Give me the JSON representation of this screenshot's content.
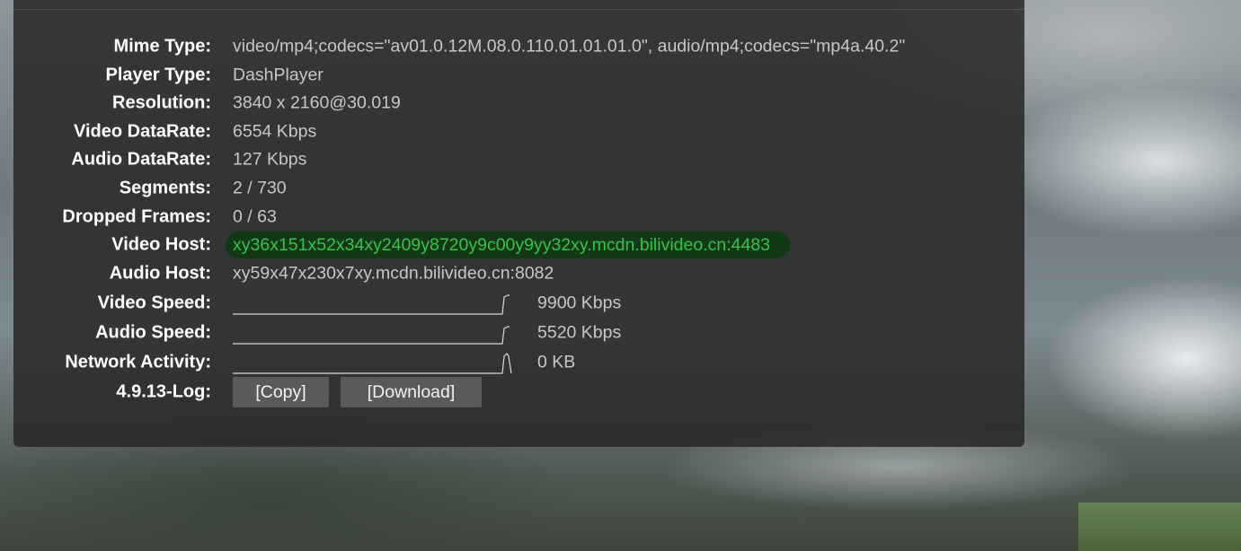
{
  "stats": {
    "mime_type": {
      "label": "Mime Type:",
      "value": "video/mp4;codecs=\"av01.0.12M.08.0.110.01.01.01.0\", audio/mp4;codecs=\"mp4a.40.2\""
    },
    "player_type": {
      "label": "Player Type:",
      "value": "DashPlayer"
    },
    "resolution": {
      "label": "Resolution:",
      "value": "3840 x 2160@30.019"
    },
    "video_datarate": {
      "label": "Video DataRate:",
      "value": "6554 Kbps"
    },
    "audio_datarate": {
      "label": "Audio DataRate:",
      "value": "127 Kbps"
    },
    "segments": {
      "label": "Segments:",
      "value": "2 / 730"
    },
    "dropped_frames": {
      "label": "Dropped Frames:",
      "value": "0 / 63"
    },
    "video_host": {
      "label": "Video Host:",
      "value": "xy36x151x52x34xy2409y8720y9c00y9yy32xy.mcdn.bilivideo.cn:4483"
    },
    "audio_host": {
      "label": "Audio Host:",
      "value": "xy59x47x230x7xy.mcdn.bilivideo.cn:8082"
    },
    "video_speed": {
      "label": "Video Speed:",
      "value": "9900 Kbps"
    },
    "audio_speed": {
      "label": "Audio Speed:",
      "value": "5520 Kbps"
    },
    "network_activity": {
      "label": "Network Activity:",
      "value": "0 KB"
    },
    "log": {
      "label": "4.9.13-Log:",
      "copy_label": "[Copy]",
      "download_label": "[Download]"
    }
  },
  "colors": {
    "panel_bg": "#282828",
    "label_text": "#ffffff",
    "value_text": "#c7c7c7",
    "highlight_text": "#36c24b",
    "highlight_bg": "#123816",
    "button_bg": "#5a5a5a"
  }
}
